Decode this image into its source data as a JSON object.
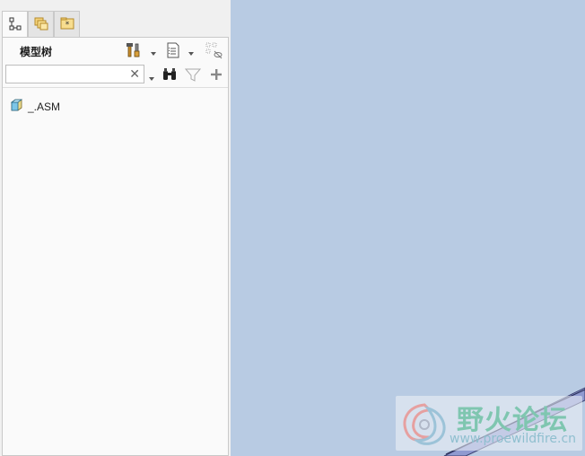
{
  "tabs": [
    {
      "name": "model-tree-tab",
      "icon": "tree-icon",
      "active": true
    },
    {
      "name": "folder-browser-tab",
      "icon": "folders-icon",
      "active": false
    },
    {
      "name": "favorites-tab",
      "icon": "favorites-folder-icon",
      "active": false
    }
  ],
  "panel": {
    "title": "模型树",
    "search": {
      "value": "",
      "placeholder": "",
      "clear_glyph": "✕"
    },
    "toolbar_icons": [
      "settings-tools-icon",
      "show-list-icon",
      "hide-toggle-icon",
      "find-binoculars-icon",
      "filter-icon",
      "add-icon"
    ]
  },
  "tree": {
    "items": [
      {
        "label": "_.ASM",
        "icon": "assembly-icon"
      }
    ]
  },
  "watermark": {
    "text": "野火论坛",
    "url": "www.proewildfire.cn"
  },
  "colors": {
    "canvas_background": "#b8cbe3",
    "panel_background": "#fafafa"
  }
}
